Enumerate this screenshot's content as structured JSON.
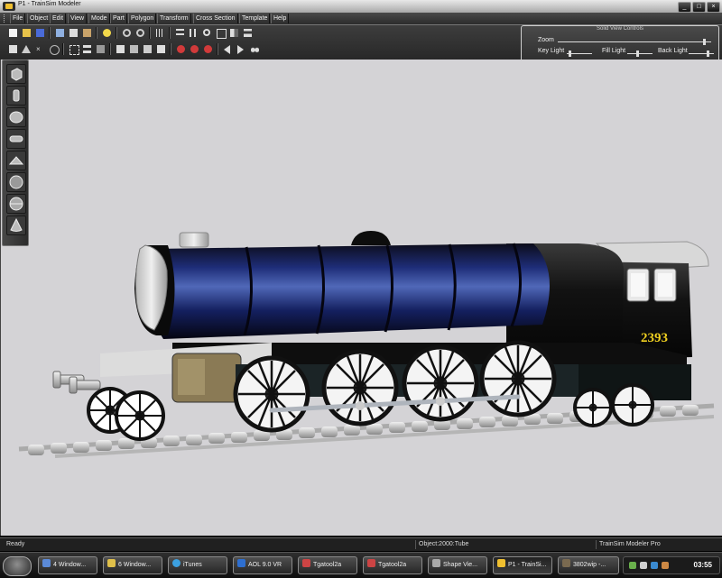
{
  "window": {
    "title": "P1 - TrainSim Modeler",
    "min": "_",
    "max": "□",
    "close": "×"
  },
  "menu": [
    "File",
    "Object",
    "Edit",
    "View",
    "Mode",
    "Part",
    "Polygon",
    "Transform",
    "Cross Section",
    "Template",
    "Help"
  ],
  "solid_view_controls": {
    "title": "Solid View Controls",
    "zoom_label": "Zoom",
    "key_light_label": "Key Light",
    "fill_light_label": "Fill Light",
    "back_light_label": "Back Light"
  },
  "model": {
    "number_plate": "2393"
  },
  "status": {
    "left": "Ready",
    "middle": "Object:2000:Tube",
    "right": "TrainSim Modeler Pro"
  },
  "taskbar": {
    "tasks": [
      "4 Window...",
      "6 Window...",
      "iTunes",
      "AOL 9.0 VR",
      "Tgatool2a",
      "Tgatool2a",
      "Shape Vie...",
      "P1 - TrainSi...",
      "3802wip -..."
    ],
    "clock": "03:55"
  },
  "colors": {
    "viewport_bg": "#d4d3d6",
    "boiler_blue": "#1a2a6e",
    "loco_black": "#101010"
  }
}
